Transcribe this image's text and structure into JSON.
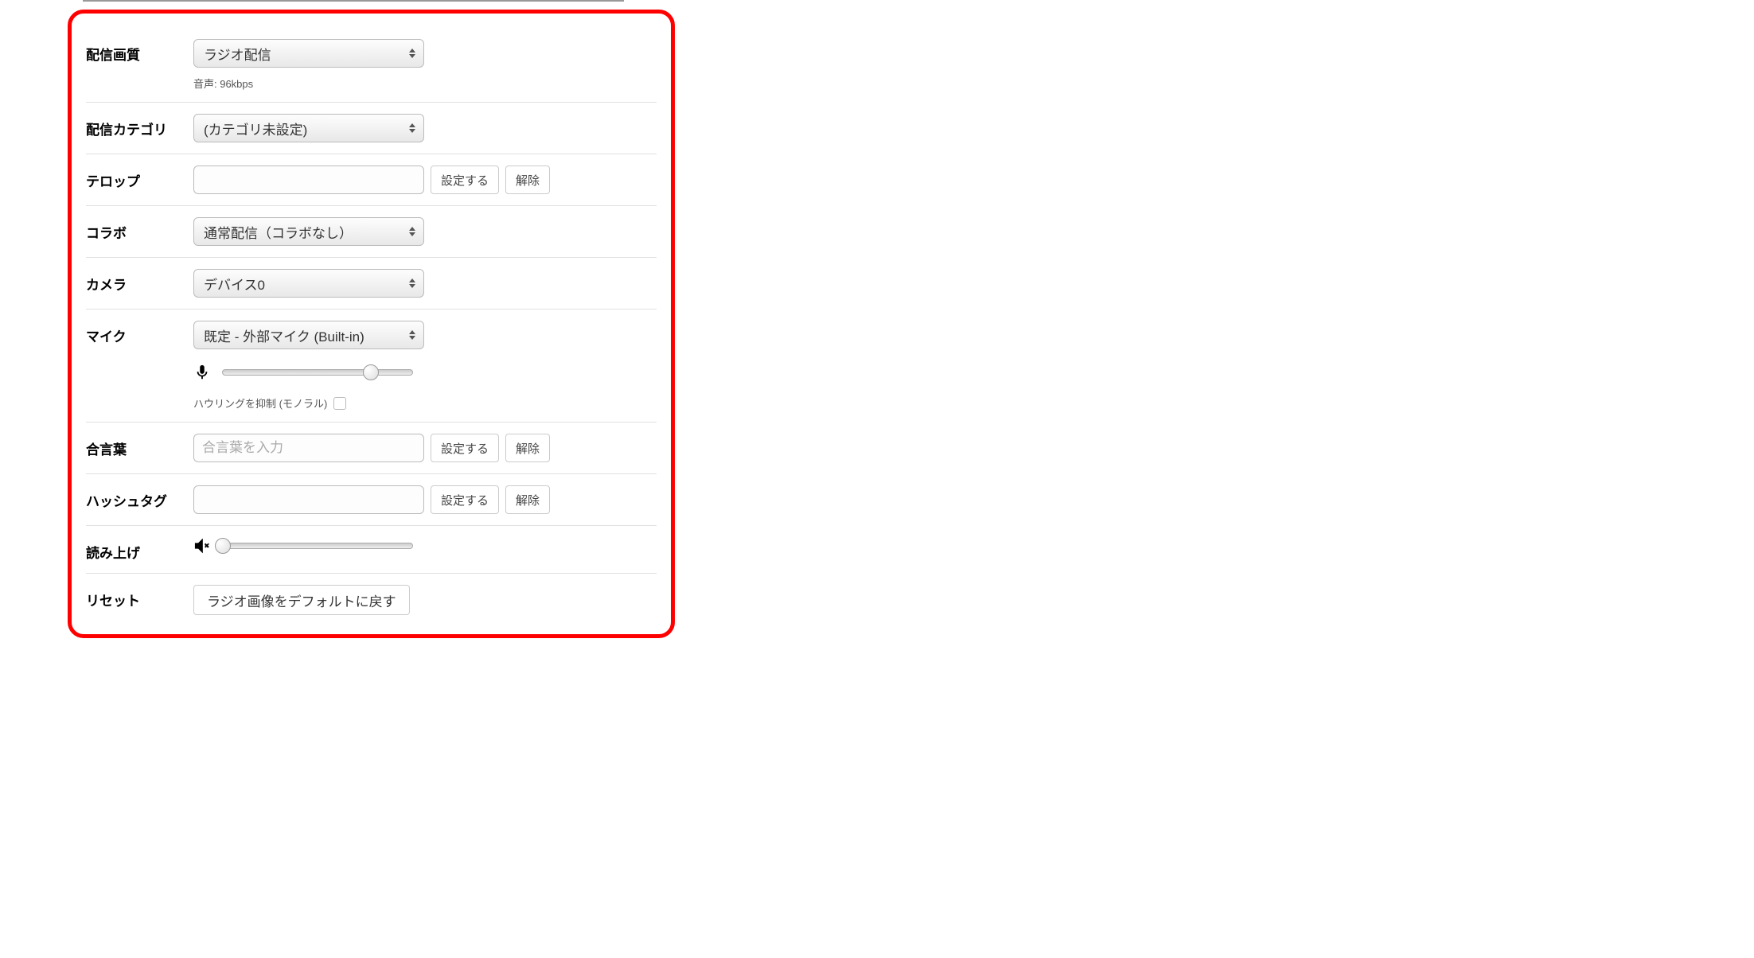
{
  "rows": {
    "quality": {
      "label": "配信画質",
      "selected": "ラジオ配信",
      "subtext": "音声: 96kbps"
    },
    "category": {
      "label": "配信カテゴリ",
      "selected": "(カテゴリ未設定)"
    },
    "telop": {
      "label": "テロップ",
      "value": "",
      "set_btn": "設定する",
      "clear_btn": "解除"
    },
    "collab": {
      "label": "コラボ",
      "selected": "通常配信（コラボなし）"
    },
    "camera": {
      "label": "カメラ",
      "selected": "デバイス0"
    },
    "mic": {
      "label": "マイク",
      "selected": "既定 - 外部マイク (Built-in)",
      "slider_percent": 78,
      "howling_label": "ハウリングを抑制 (モノラル)",
      "howling_checked": false
    },
    "password": {
      "label": "合言葉",
      "placeholder": "合言葉を入力",
      "value": "",
      "set_btn": "設定する",
      "clear_btn": "解除"
    },
    "hashtag": {
      "label": "ハッシュタグ",
      "value": "",
      "set_btn": "設定する",
      "clear_btn": "解除"
    },
    "readout": {
      "label": "読み上げ",
      "slider_percent": 0
    },
    "reset": {
      "label": "リセット",
      "button": "ラジオ画像をデフォルトに戻す"
    }
  }
}
